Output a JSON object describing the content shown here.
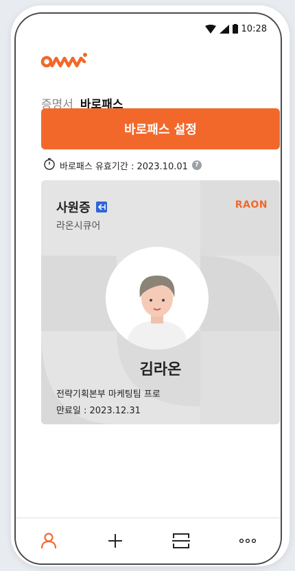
{
  "status_bar": {
    "time": "10:28"
  },
  "brand": {
    "logo_text": "omni",
    "card_logo": "RAON"
  },
  "tabs": [
    {
      "label": "증명서",
      "active": false
    },
    {
      "label": "바로패스",
      "active": true
    }
  ],
  "primary_button": {
    "label": "바로패스 설정"
  },
  "expiry": {
    "label": "바로패스 유효기간 : 2023.10.01",
    "help": "?"
  },
  "card": {
    "title": "사원증",
    "company": "라온시큐어",
    "name": "김라온",
    "department": "전략기획본부 마케팅팀 프로",
    "valid_until": "만료일 : 2023.12.31"
  },
  "bottom_nav": [
    {
      "icon": "person-icon",
      "active": true
    },
    {
      "icon": "plus-icon",
      "active": false
    },
    {
      "icon": "scan-icon",
      "active": false
    },
    {
      "icon": "more-icon",
      "active": false
    }
  ],
  "colors": {
    "accent": "#f2682b",
    "badge": "#2d66d8",
    "card_bg": "#e4e4e4"
  }
}
